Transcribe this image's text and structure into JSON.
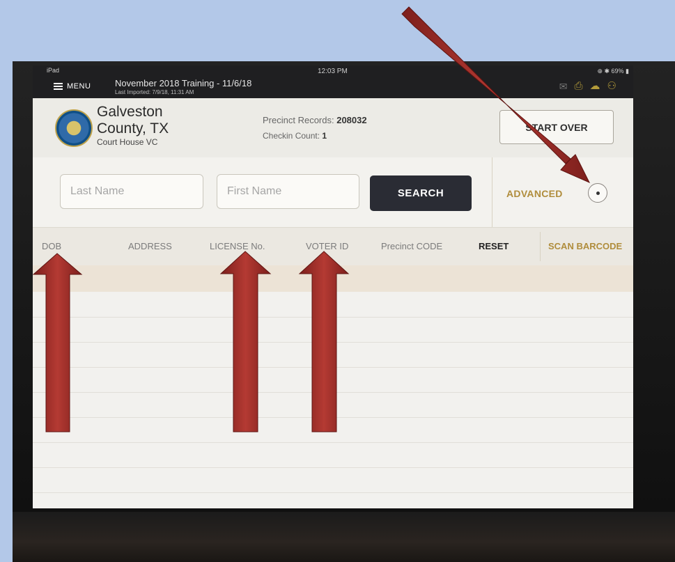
{
  "status_bar": {
    "device": "iPad",
    "time": "12:03 PM",
    "battery": "69%"
  },
  "app_bar": {
    "menu_label": "MENU",
    "title": "November 2018 Training - 11/6/18",
    "last_imported": "Last Imported: 7/9/18, 11:31 AM",
    "icons": [
      "mail-icon",
      "printer-icon",
      "cloud-upload-icon",
      "users-icon"
    ]
  },
  "header": {
    "county_line1": "Galveston",
    "county_line2": "County, TX",
    "location": "Court House VC",
    "precinct_records_label": "Precinct Records:",
    "precinct_records_value": "208032",
    "checkin_label": "Checkin Count:",
    "checkin_value": "1",
    "start_over_label": "START OVER"
  },
  "search": {
    "last_name_placeholder": "Last Name",
    "first_name_placeholder": "First Name",
    "search_label": "SEARCH",
    "advanced_label": "ADVANCED"
  },
  "filter_tabs": {
    "dob": "DOB",
    "address": "ADDRESS",
    "license": "LICENSE No.",
    "voter_id": "VOTER ID",
    "precinct_code": "Precinct CODE",
    "reset": "RESET",
    "scan_barcode": "SCAN BARCODE"
  },
  "colors": {
    "accent_gold": "#b08d3c",
    "dark_button": "#2a2c34",
    "arrow_red": "#a0302c",
    "backdrop": "#b3c8e8"
  }
}
